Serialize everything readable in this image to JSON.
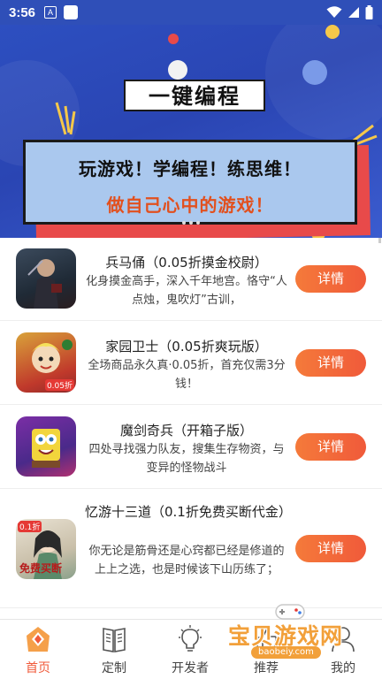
{
  "status_bar": {
    "time": "3:56",
    "icon_a": "A"
  },
  "banner": {
    "title": "一键编程",
    "line1": "玩游戏！学编程！练思维！",
    "line2": "做自己心中的游戏！"
  },
  "games": [
    {
      "title": "兵马俑（0.05折摸金校尉）",
      "desc": "化身摸金高手，深入千年地宫。恪守“人点烛，鬼吹灯”古训，",
      "button": "详情"
    },
    {
      "title": "家园卫士（0.05折爽玩版）",
      "desc": "全场商品永久真·0.05折，首充仅需3分钱！",
      "button": "详情",
      "badge": "0.05折"
    },
    {
      "title": "魔剑奇兵（开箱子版）",
      "desc": "四处寻找强力队友，搜集生存物资，与变异的怪物战斗",
      "button": "详情"
    },
    {
      "title": "忆游十三道（0.1折免费买断代金）",
      "desc": "你无论是筋骨还是心窍都已经是修道的上上之选，也是时候该下山历练了；",
      "button": "详情",
      "badge": "0.1折",
      "thumb_text": "免费买断"
    }
  ],
  "nav": [
    {
      "label": "首页",
      "icon": "home-icon",
      "active": true
    },
    {
      "label": "定制",
      "icon": "book-icon",
      "active": false
    },
    {
      "label": "开发者",
      "icon": "lightbulb-icon",
      "active": false
    },
    {
      "label": "推荐",
      "icon": "recommend-icon",
      "active": false
    },
    {
      "label": "我的",
      "icon": "user-icon",
      "active": false
    }
  ],
  "watermark": {
    "text": "宝贝游戏网",
    "url": "baobeiy.com"
  },
  "colors": {
    "accent": "#f05a3a",
    "banner": "#2f4fb8",
    "button": "#f57a3a"
  }
}
